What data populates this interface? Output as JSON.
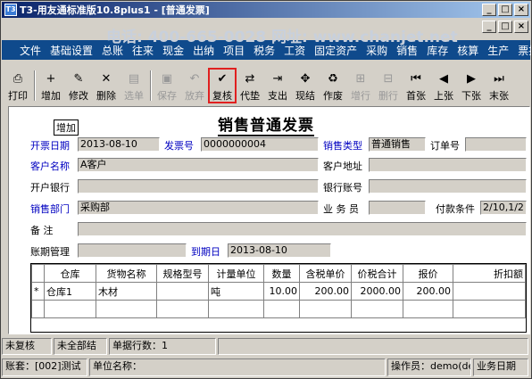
{
  "window": {
    "title": "T3-用友通标准版10.8plus1 - [普通发票]",
    "controls": [
      "_",
      "□",
      "×"
    ],
    "mdi_controls": [
      "_",
      "□",
      "×"
    ]
  },
  "menu": [
    "文件",
    "基础设置",
    "总账",
    "往来",
    "现金",
    "出纳",
    "项目",
    "税务",
    "工资",
    "固定资产",
    "采购",
    "销售",
    "库存",
    "核算",
    "生产",
    "票据"
  ],
  "toolbar": [
    {
      "label": "打印",
      "icon": "printer-icon",
      "glyph": "⎙",
      "enabled": true
    },
    {
      "label": "增加",
      "icon": "add-icon",
      "glyph": "+",
      "enabled": true
    },
    {
      "label": "修改",
      "icon": "edit-icon",
      "glyph": "✎",
      "enabled": true
    },
    {
      "label": "删除",
      "icon": "delete-icon",
      "glyph": "✕",
      "enabled": true
    },
    {
      "label": "选单",
      "icon": "select-icon",
      "glyph": "▤",
      "enabled": false
    },
    {
      "label": "保存",
      "icon": "save-icon",
      "glyph": "▣",
      "enabled": false
    },
    {
      "label": "放弃",
      "icon": "undo-icon",
      "glyph": "↶",
      "enabled": false
    },
    {
      "label": "复核",
      "icon": "review-icon",
      "glyph": "✔",
      "enabled": true
    },
    {
      "label": "代垫",
      "icon": "advance-icon",
      "glyph": "⇄",
      "enabled": true
    },
    {
      "label": "支出",
      "icon": "expense-icon",
      "glyph": "⇥",
      "enabled": true
    },
    {
      "label": "现结",
      "icon": "cash-settle-icon",
      "glyph": "✥",
      "enabled": true
    },
    {
      "label": "作废",
      "icon": "void-icon",
      "glyph": "♻",
      "enabled": true
    },
    {
      "label": "增行",
      "icon": "add-row-icon",
      "glyph": "⊞",
      "enabled": false
    },
    {
      "label": "删行",
      "icon": "delete-row-icon",
      "glyph": "⊟",
      "enabled": false
    },
    {
      "label": "首张",
      "icon": "first-icon",
      "glyph": "⏮",
      "enabled": true
    },
    {
      "label": "上张",
      "icon": "prev-icon",
      "glyph": "◀",
      "enabled": true
    },
    {
      "label": "下张",
      "icon": "next-icon",
      "glyph": "▶",
      "enabled": true
    },
    {
      "label": "末张",
      "icon": "last-icon",
      "glyph": "⏭",
      "enabled": true
    }
  ],
  "form": {
    "title": "销售普通发票",
    "tag": "增加",
    "fields": {
      "open_date_label": "开票日期",
      "open_date": "2013-08-10",
      "invoice_no_label": "发票号",
      "invoice_no": "0000000004",
      "sale_type_label": "销售类型",
      "sale_type": "普通销售",
      "order_no_label": "订单号",
      "order_no": "",
      "customer_label": "客户名称",
      "customer": "A客户",
      "customer_addr_label": "客户地址",
      "customer_addr": "",
      "bank_label": "开户银行",
      "bank": "",
      "bank_account_label": "银行账号",
      "bank_account": "",
      "dept_label": "销售部门",
      "dept": "采购部",
      "staff_label": "业 务 员",
      "staff": "",
      "payment_label": "付款条件",
      "payment": "2/10,1/2",
      "note_label": "备  注",
      "note": "",
      "ledger_label": "账期管理",
      "ledger": "",
      "due_label": "到期日",
      "due": "2013-08-10"
    },
    "table": {
      "headers": [
        "",
        "仓库",
        "货物名称",
        "规格型号",
        "计量单位",
        "数量",
        "含税单价",
        "价税合计",
        "报价",
        "折扣额"
      ],
      "rows": [
        [
          "*",
          "仓库1",
          "木材",
          "",
          "吨",
          "10.00",
          "200.00",
          "2000.00",
          "200.00",
          ""
        ],
        [
          "",
          "",
          "",
          "",
          "",
          "",
          "",
          "",
          "",
          ""
        ],
        [
          "",
          "",
          "",
          "",
          "",
          "",
          "",
          "",
          "",
          ""
        ]
      ]
    }
  },
  "status": {
    "review": "未复核",
    "settle": "未全部结",
    "row_count": "单据行数：1"
  },
  "statusbar": {
    "account": "账套：[002]测试",
    "unit": "单位名称：",
    "operator": "操作员：demo(de",
    "date": "业务日期"
  },
  "watermark": "电话: 400-665-0028  网址: www.chanjet.net"
}
